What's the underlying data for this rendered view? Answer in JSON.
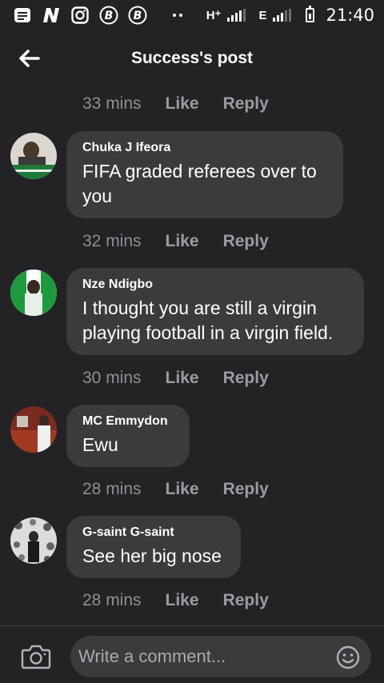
{
  "status_bar": {
    "time": "21:40",
    "network_h": "H⁺",
    "network_e": "E",
    "icons": [
      "messages-icon",
      "n-app-icon",
      "instagram-icon",
      "b-app-icon",
      "b-app-icon-2",
      "more-dots-icon",
      "signal-icon",
      "battery-icon"
    ]
  },
  "header": {
    "title": "Success's post"
  },
  "top_meta": {
    "time": "33 mins",
    "like": "Like",
    "reply": "Reply"
  },
  "comments": [
    {
      "name": "Chuka J Ifeora",
      "text": "FIFA graded referees over to you",
      "time": "32 mins",
      "like": "Like",
      "reply": "Reply"
    },
    {
      "name": "Nze Ndigbo",
      "text": "I thought you are still a virgin playing football in a virgin field.",
      "time": "30 mins",
      "like": "Like",
      "reply": "Reply"
    },
    {
      "name": "MC Emmydon",
      "text": "Ewu",
      "time": "28 mins",
      "like": "Like",
      "reply": "Reply"
    },
    {
      "name": "G-saint G-saint",
      "text": "See her big nose",
      "time": "28 mins",
      "like": "Like",
      "reply": "Reply"
    }
  ],
  "composer": {
    "placeholder": "Write a comment..."
  },
  "colors": {
    "background": "#232326",
    "bubble": "#3a3b3c",
    "meta_text": "#9a9ca1"
  }
}
